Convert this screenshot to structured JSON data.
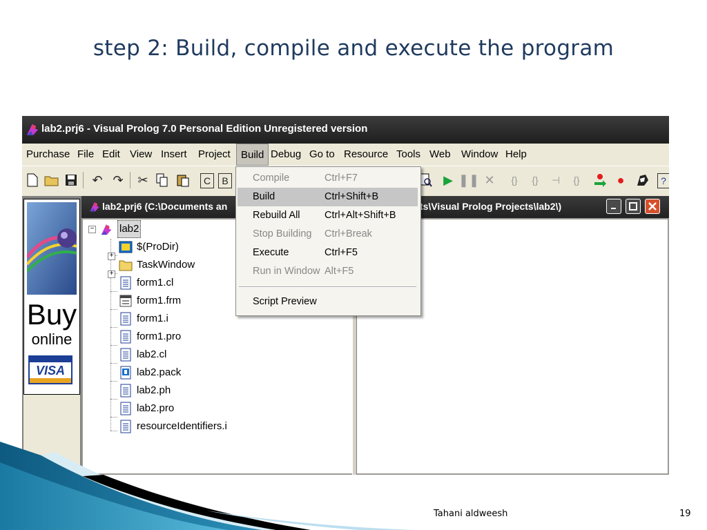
{
  "slide": {
    "title": "step 2: Build, compile and execute the program",
    "author": "Tahani aldweesh",
    "page_number": "19"
  },
  "app": {
    "title": "lab2.prj6 - Visual Prolog 7.0 Personal Edition Unregistered version"
  },
  "menubar": {
    "items": [
      "Purchase",
      "File",
      "Edit",
      "View",
      "Insert",
      "Project",
      "Build",
      "Debug",
      "Go to",
      "Resource",
      "Tools",
      "Web",
      "Window",
      "Help"
    ],
    "active": "Build"
  },
  "toolbar": {
    "icons": [
      "new-file-icon",
      "open-folder-icon",
      "save-icon",
      "undo-icon",
      "redo-icon",
      "cut-icon",
      "copy-icon",
      "paste-icon",
      "c-box-icon",
      "b-box-icon",
      "find-icon",
      "run-icon",
      "pause-icon",
      "stop-icon",
      "step-into-icon",
      "step-over-icon",
      "step-out-icon",
      "run-to-cursor-icon",
      "breakpoint-arrow-icon",
      "breakpoint-icon",
      "debug-icon",
      "help-icon"
    ]
  },
  "ad": {
    "buy": "Buy",
    "online": "online",
    "visa": "VISA"
  },
  "project_window": {
    "title_left": "lab2.prj6 (C:\\Documents an",
    "title_right": "ts\\Visual Prolog Projects\\lab2\\)"
  },
  "tree": {
    "root": "lab2",
    "nodes": [
      {
        "label": "$(ProDir)",
        "icon": "pro-dir-icon",
        "expandable": true
      },
      {
        "label": "TaskWindow",
        "icon": "folder-icon",
        "expandable": true
      },
      {
        "label": "form1.cl",
        "icon": "file-icon",
        "expandable": false
      },
      {
        "label": "form1.frm",
        "icon": "form-file-icon",
        "expandable": false
      },
      {
        "label": "form1.i",
        "icon": "file-icon",
        "expandable": false
      },
      {
        "label": "form1.pro",
        "icon": "file-icon",
        "expandable": false
      },
      {
        "label": "lab2.cl",
        "icon": "file-icon",
        "expandable": false
      },
      {
        "label": "lab2.pack",
        "icon": "pack-file-icon",
        "expandable": false
      },
      {
        "label": "lab2.ph",
        "icon": "file-icon",
        "expandable": false
      },
      {
        "label": "lab2.pro",
        "icon": "file-icon",
        "expandable": false
      },
      {
        "label": "resourceIdentifiers.i",
        "icon": "file-icon",
        "expandable": false
      }
    ]
  },
  "build_menu": {
    "items": [
      {
        "label": "Compile",
        "shortcut": "Ctrl+F7",
        "enabled": false
      },
      {
        "label": "Build",
        "shortcut": "Ctrl+Shift+B",
        "enabled": true,
        "highlighted": true
      },
      {
        "label": "Rebuild All",
        "shortcut": "Ctrl+Alt+Shift+B",
        "enabled": true
      },
      {
        "label": "Stop Building",
        "shortcut": "Ctrl+Break",
        "enabled": false
      },
      {
        "label": "Execute",
        "shortcut": "Ctrl+F5",
        "enabled": true
      },
      {
        "label": "Run in Window",
        "shortcut": "Alt+F5",
        "enabled": false
      },
      {
        "label": "Script Preview",
        "shortcut": "",
        "enabled": true
      }
    ]
  },
  "colors": {
    "title_text": "#1f3a5e",
    "titlebar_bg": "#2a2a2a",
    "menubar_bg": "#ece9d8",
    "menu_highlight": "#c6c6c6",
    "close_button": "#d5502c",
    "deco_blue": "#2b8fb8"
  }
}
